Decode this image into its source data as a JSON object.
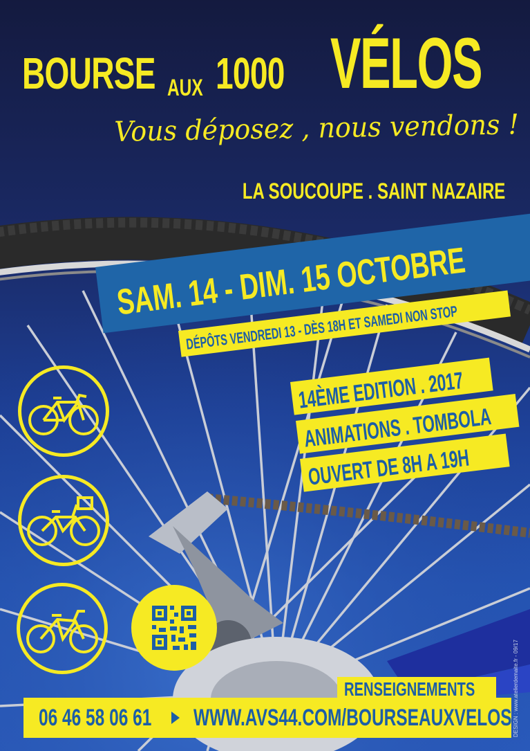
{
  "colors": {
    "accent_yellow": "#f6ea23",
    "band_blue": "#1f65a8",
    "text_blue": "#1c5ea6",
    "sky_dark": "#141a3f",
    "sky_light": "#2a5cbe"
  },
  "title": {
    "word1": "BOURSE",
    "word2": "AUX",
    "word3": "1000",
    "word4": "VÉLOS"
  },
  "tagline": "Vous déposez , nous vendons !",
  "venue": "LA SOUCOUPE . SAINT NAZAIRE",
  "dates": "SAM. 14 - DIM. 15 OCTOBRE",
  "deposits": "DÉPÔTS VENDREDI 13 - DÈS 18H ET SAMEDI NON STOP",
  "edition": "14ÈME EDITION . 2017",
  "animations": "ANIMATIONS . TOMBOLA",
  "hours": "OUVERT DE 8H A 19H",
  "icons": [
    "road-bike-icon",
    "city-bike-icon",
    "mountain-bike-icon",
    "qr-code-icon"
  ],
  "footer": {
    "info_label": "RENSEIGNEMENTS",
    "phone": "06 46 58 06 61",
    "website": "WWW.AVS44.COM/BOURSEAUXVELOS"
  },
  "credit": "DESIGN : www.atelierdemaite.fr - 09/17"
}
